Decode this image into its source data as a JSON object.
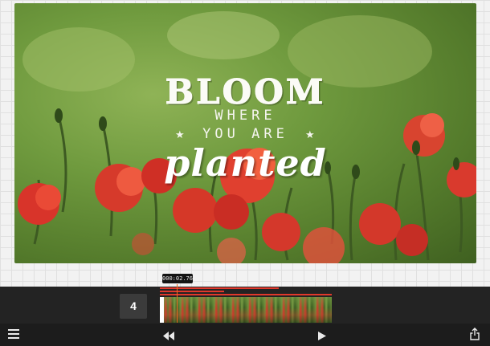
{
  "preview": {
    "line1": "BLOOM",
    "line2": "WHERE",
    "line3": "YOU ARE",
    "line4": "planted"
  },
  "timeline": {
    "playhead_time": "000:02.76",
    "clip_count": "4"
  },
  "toolbar": {
    "menu_icon": "hamburger-menu-icon",
    "rewind_icon": "rewind-icon",
    "play_icon": "play-icon",
    "share_icon": "share-icon"
  },
  "colors": {
    "accent": "#f06a20",
    "clip_red": "#e0382b",
    "timeline_bg": "#232323",
    "toolbar_bg": "#1c1c1c"
  }
}
